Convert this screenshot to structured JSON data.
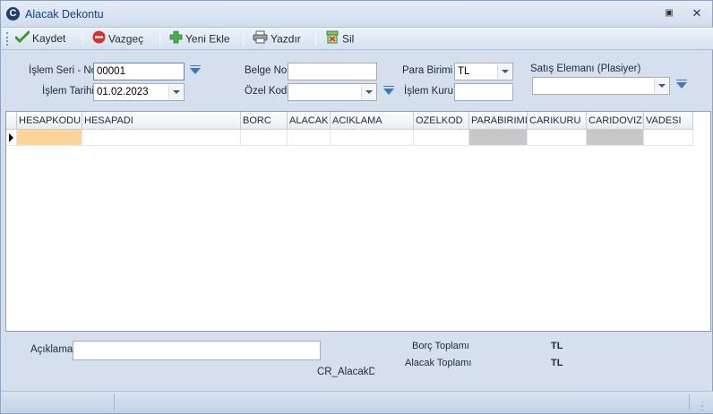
{
  "window": {
    "title": "Alacak Dekontu",
    "restore_glyph": "▣",
    "close_glyph": "✕",
    "app_icon_letter": "C"
  },
  "toolbar": {
    "save_label": "Kaydet",
    "cancel_label": "Vazgeç",
    "new_label": "Yeni Ekle",
    "print_label": "Yazdır",
    "delete_label": "Sil"
  },
  "form": {
    "seri_no_label": "İşlem Seri - No",
    "seri_no_value": "00001",
    "tarih_label": "İşlem Tarihi",
    "tarih_value": "01.02.2023",
    "belge_no_label": "Belge No",
    "belge_no_value": "",
    "ozel_kod_label": "Özel Kod",
    "ozel_kod_value": "",
    "para_birimi_label": "Para Birimi",
    "para_birimi_value": "TL",
    "islem_kuru_label": "İşlem Kuru",
    "islem_kuru_value": "",
    "satis_elemani_label": "Satış Elemanı (Plasiyer)",
    "satis_elemani_value": ""
  },
  "grid": {
    "columns": [
      "HESAPKODU",
      "HESAPADI",
      "BORC",
      "ALACAK",
      "ACIKLAMA",
      "OZELKOD",
      "PARABIRIMI",
      "CARIKURU",
      "CARIDOVIZI",
      "VADESI"
    ]
  },
  "bottom": {
    "aciklama_label": "Açıklama",
    "aciklama_value": "",
    "report_label": "CR_AlacakDe",
    "borc_toplami_label": "Borç Toplamı",
    "borc_toplami_currency": "TL",
    "alacak_toplami_label": "Alacak Toplamı",
    "alacak_toplami_currency": "TL"
  },
  "colors": {
    "accent": "#15428b",
    "selected_cell": "#fdd49a",
    "readonly_cell": "#c8c8c8"
  }
}
